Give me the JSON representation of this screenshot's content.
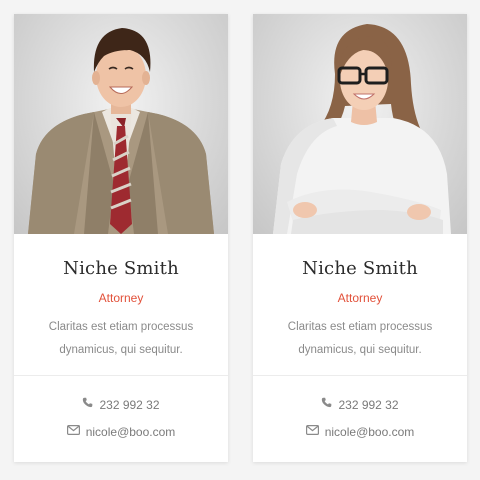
{
  "cards": [
    {
      "name": "Niche Smith",
      "role": "Attorney",
      "description": "Claritas est etiam processus dynamicus, qui sequitur.",
      "phone": "232 992 32",
      "email": "nicole@boo.com",
      "phone_icon": "phone-icon",
      "email_icon": "envelope-icon"
    },
    {
      "name": "Niche Smith",
      "role": "Attorney",
      "description": "Claritas est etiam processus dynamicus, qui sequitur.",
      "phone": "232 992 32",
      "email": "nicole@boo.com",
      "phone_icon": "phone-icon",
      "email_icon": "envelope-icon"
    }
  ],
  "colors": {
    "accent": "#e2513a",
    "name_text": "#2b2b2b",
    "body_text": "#8a8a8a",
    "background": "#f4f4f4",
    "card": "#ffffff"
  }
}
